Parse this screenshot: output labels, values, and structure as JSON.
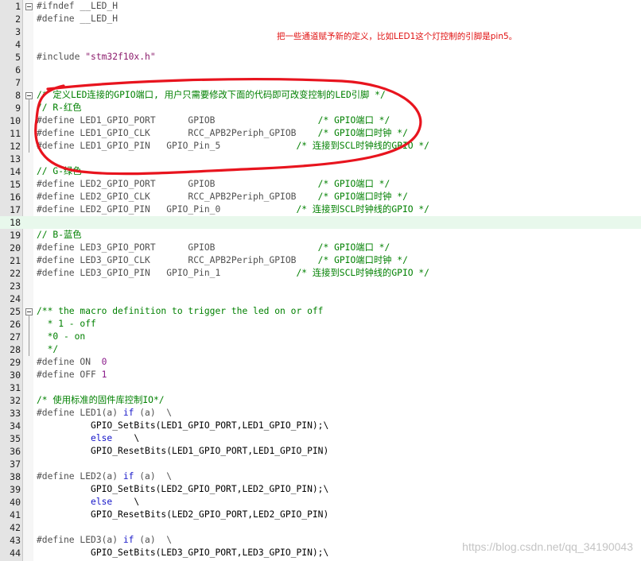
{
  "annotation": "把一些通道赋予新的定义，比如LED1这个灯控制的引脚是pin5。",
  "watermark": "https://blog.csdn.net/qq_34190043",
  "current_line": 18,
  "highlight_color": "#e8f8ec",
  "annotation_color": "#e01010",
  "fold_markers": [
    1,
    8,
    25
  ],
  "lines": [
    {
      "n": "1",
      "t": [
        [
          "pp",
          "#ifndef __LED_H"
        ]
      ]
    },
    {
      "n": "2",
      "t": [
        [
          "pp",
          "#define __LED_H"
        ]
      ]
    },
    {
      "n": "3",
      "t": []
    },
    {
      "n": "4",
      "t": []
    },
    {
      "n": "5",
      "t": [
        [
          "pp",
          "#include "
        ],
        [
          "str",
          "\"stm32f10x.h\""
        ]
      ]
    },
    {
      "n": "6",
      "t": []
    },
    {
      "n": "7",
      "t": []
    },
    {
      "n": "8",
      "t": [
        [
          "cm",
          "/* 定义LED连接的GPIO端口, 用户只需要修改下面的代码即可改变控制的LED引脚 */"
        ]
      ]
    },
    {
      "n": "9",
      "t": [
        [
          "cm",
          "// R-红色"
        ]
      ]
    },
    {
      "n": "10",
      "t": [
        [
          "pp",
          "#define LED1_GPIO_PORT      GPIOB                   "
        ],
        [
          "cm",
          "/* GPIO端口 */"
        ]
      ]
    },
    {
      "n": "11",
      "t": [
        [
          "pp",
          "#define LED1_GPIO_CLK       RCC_APB2Periph_GPIOB    "
        ],
        [
          "cm",
          "/* GPIO端口时钟 */"
        ]
      ]
    },
    {
      "n": "12",
      "t": [
        [
          "pp",
          "#define LED1_GPIO_PIN   GPIO_Pin_5              "
        ],
        [
          "cm",
          "/* 连接到SCL时钟线的GPIO */"
        ]
      ]
    },
    {
      "n": "13",
      "t": []
    },
    {
      "n": "14",
      "t": [
        [
          "cm",
          "// G-绿色"
        ]
      ]
    },
    {
      "n": "15",
      "t": [
        [
          "pp",
          "#define LED2_GPIO_PORT      GPIOB                   "
        ],
        [
          "cm",
          "/* GPIO端口 */"
        ]
      ]
    },
    {
      "n": "16",
      "t": [
        [
          "pp",
          "#define LED2_GPIO_CLK       RCC_APB2Periph_GPIOB    "
        ],
        [
          "cm",
          "/* GPIO端口时钟 */"
        ]
      ]
    },
    {
      "n": "17",
      "t": [
        [
          "pp",
          "#define LED2_GPIO_PIN   GPIO_Pin_0              "
        ],
        [
          "cm",
          "/* 连接到SCL时钟线的GPIO */"
        ]
      ]
    },
    {
      "n": "18",
      "t": []
    },
    {
      "n": "19",
      "t": [
        [
          "cm",
          "// B-蓝色"
        ]
      ]
    },
    {
      "n": "20",
      "t": [
        [
          "pp",
          "#define LED3_GPIO_PORT      GPIOB                   "
        ],
        [
          "cm",
          "/* GPIO端口 */"
        ]
      ]
    },
    {
      "n": "21",
      "t": [
        [
          "pp",
          "#define LED3_GPIO_CLK       RCC_APB2Periph_GPIOB    "
        ],
        [
          "cm",
          "/* GPIO端口时钟 */"
        ]
      ]
    },
    {
      "n": "22",
      "t": [
        [
          "pp",
          "#define LED3_GPIO_PIN   GPIO_Pin_1              "
        ],
        [
          "cm",
          "/* 连接到SCL时钟线的GPIO */"
        ]
      ]
    },
    {
      "n": "23",
      "t": []
    },
    {
      "n": "24",
      "t": []
    },
    {
      "n": "25",
      "t": [
        [
          "cm",
          "/** the macro definition to trigger the led on or off"
        ]
      ]
    },
    {
      "n": "26",
      "t": [
        [
          "cm",
          "  * 1 - off"
        ]
      ]
    },
    {
      "n": "27",
      "t": [
        [
          "cm",
          "  *0 - on"
        ]
      ]
    },
    {
      "n": "28",
      "t": [
        [
          "cm",
          "  */"
        ]
      ]
    },
    {
      "n": "29",
      "t": [
        [
          "pp",
          "#define ON  "
        ],
        [
          "num",
          "0"
        ]
      ]
    },
    {
      "n": "30",
      "t": [
        [
          "pp",
          "#define OFF "
        ],
        [
          "num",
          "1"
        ]
      ]
    },
    {
      "n": "31",
      "t": []
    },
    {
      "n": "32",
      "t": [
        [
          "cm",
          "/* 使用标准的固件库控制IO*/"
        ]
      ]
    },
    {
      "n": "33",
      "t": [
        [
          "pp",
          "#define LED1(a) "
        ],
        [
          "kw",
          "if"
        ],
        [
          "pp",
          " (a)  \\"
        ]
      ]
    },
    {
      "n": "34",
      "t": [
        [
          "",
          "          GPIO_SetBits(LED1_GPIO_PORT,LED1_GPIO_PIN);\\"
        ]
      ]
    },
    {
      "n": "35",
      "t": [
        [
          "kw",
          "          else"
        ],
        [
          "",
          "    \\"
        ]
      ]
    },
    {
      "n": "36",
      "t": [
        [
          "",
          "          GPIO_ResetBits(LED1_GPIO_PORT,LED1_GPIO_PIN)"
        ]
      ]
    },
    {
      "n": "37",
      "t": []
    },
    {
      "n": "38",
      "t": [
        [
          "pp",
          "#define LED2(a) "
        ],
        [
          "kw",
          "if"
        ],
        [
          "pp",
          " (a)  \\"
        ]
      ]
    },
    {
      "n": "39",
      "t": [
        [
          "",
          "          GPIO_SetBits(LED2_GPIO_PORT,LED2_GPIO_PIN);\\"
        ]
      ]
    },
    {
      "n": "40",
      "t": [
        [
          "kw",
          "          else"
        ],
        [
          "",
          "    \\"
        ]
      ]
    },
    {
      "n": "41",
      "t": [
        [
          "",
          "          GPIO_ResetBits(LED2_GPIO_PORT,LED2_GPIO_PIN)"
        ]
      ]
    },
    {
      "n": "42",
      "t": []
    },
    {
      "n": "43",
      "t": [
        [
          "pp",
          "#define LED3(a) "
        ],
        [
          "kw",
          "if"
        ],
        [
          "pp",
          " (a)  \\"
        ]
      ]
    },
    {
      "n": "44",
      "t": [
        [
          "",
          "          GPIO_SetBits(LED3_GPIO_PORT,LED3_GPIO_PIN);\\"
        ]
      ]
    }
  ]
}
